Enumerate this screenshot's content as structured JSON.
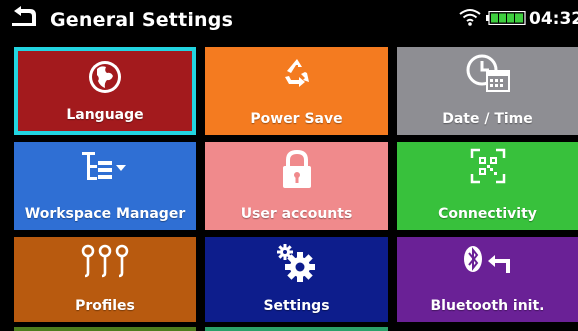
{
  "header": {
    "title": "General Settings",
    "time": "04:32",
    "back_icon": "back-arrow-icon",
    "wifi_icon": "wifi-icon",
    "battery_icon": "battery-icon"
  },
  "tiles": [
    {
      "label": "Language",
      "icon": "globe-icon",
      "color": "#a31a1d",
      "selected": true
    },
    {
      "label": "Power Save",
      "icon": "recycle-icon",
      "color": "#f47b20"
    },
    {
      "label": "Date / Time",
      "icon": "clock-calendar-icon",
      "color": "#8e8e93"
    },
    {
      "label": "Workspace Manager",
      "icon": "tree-structure-icon",
      "color": "#2f6fd4"
    },
    {
      "label": "User accounts",
      "icon": "lock-icon",
      "color": "#f08a8c"
    },
    {
      "label": "Connectivity",
      "icon": "qr-code-icon",
      "color": "#38c13c"
    },
    {
      "label": "Profiles",
      "icon": "profiles-icon",
      "color": "#b85a0f"
    },
    {
      "label": "Settings",
      "icon": "gears-icon",
      "color": "#0d1d8c"
    },
    {
      "label": "Bluetooth init.",
      "icon": "bluetooth-reset-icon",
      "color": "#6a2196"
    }
  ],
  "peek_colors": [
    "#4e7d1e",
    "#2aa06a"
  ]
}
